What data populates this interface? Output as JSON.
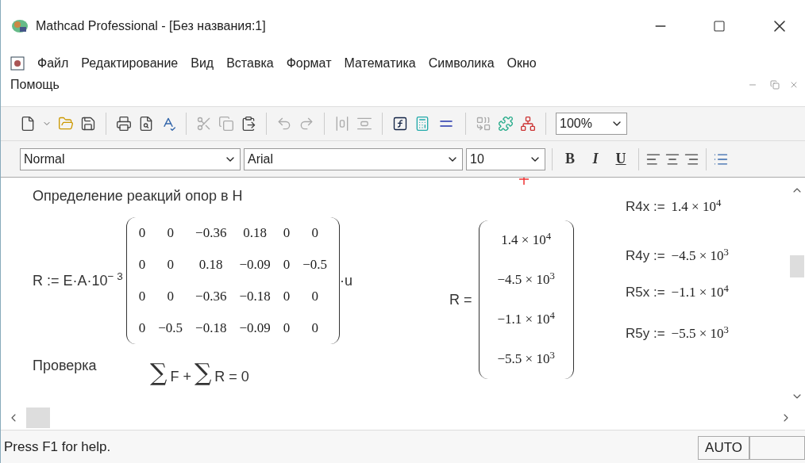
{
  "window": {
    "title": "Mathcad Professional - [Без названия:1]"
  },
  "menu": [
    "Файл",
    "Редактирование",
    "Вид",
    "Вставка",
    "Формат",
    "Математика",
    "Символика",
    "Окно",
    "Помощь"
  ],
  "toolbar": {
    "zoom": "100%"
  },
  "format_bar": {
    "style": "Normal",
    "font": "Arial",
    "size": "10",
    "buttons": [
      "B",
      "I",
      "U"
    ]
  },
  "worksheet": {
    "heading": "Определение реакций опор в H",
    "assignment": {
      "lhs": "R := E·A·10$^{− 3}$",
      "suffix": "·u",
      "matrix": [
        [
          "0",
          "0",
          "−0.36",
          "0.18",
          "0",
          "0"
        ],
        [
          "0",
          "0",
          "0.18",
          "−0.09",
          "0",
          "−0.5"
        ],
        [
          "0",
          "0",
          "−0.36",
          "−0.18",
          "0",
          "0"
        ],
        [
          "0",
          "−0.5",
          "−0.18",
          "−0.09",
          "0",
          "0"
        ]
      ]
    },
    "result": {
      "lhs": "R =",
      "vector": [
        "1.4 × 10$^{4}$",
        "−4.5 × 10$^{3}$",
        "−1.1 × 10$^{4}$",
        "−5.5 × 10$^{3}$"
      ]
    },
    "definitions": [
      {
        "name": "R4x :=",
        "value": "1.4 × 10$^{4}$"
      },
      {
        "name": "R4y :=",
        "value": "−4.5 × 10$^{3}$"
      },
      {
        "name": "R5x :=",
        "value": "−1.1 × 10$^{4}$"
      },
      {
        "name": "R5y :=",
        "value": "−5.5 × 10$^{3}$"
      }
    ],
    "check_label": "Проверка",
    "check": [
      {
        "kind": "sigma",
        "text": "∑"
      },
      {
        "kind": "text",
        "text": "F +"
      },
      {
        "kind": "sigma",
        "text": "∑"
      },
      {
        "kind": "text",
        "text": "R = 0"
      }
    ]
  },
  "status_bar": {
    "text": "Press F1 for help.",
    "mode": "AUTO"
  }
}
